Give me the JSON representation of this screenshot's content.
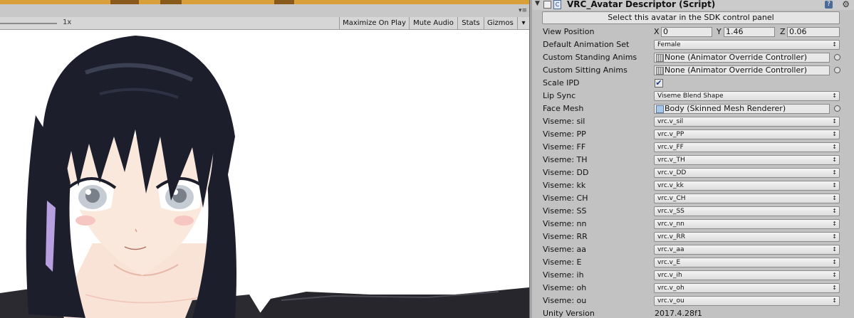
{
  "game_view": {
    "scale_label": "1x",
    "toolbar_buttons": [
      "Maximize On Play",
      "Mute Audio",
      "Stats",
      "Gizmos"
    ],
    "gizmos_arrow": "▾",
    "menu_icon": "hamburger-icon"
  },
  "inspector": {
    "component_title": "VRC_Avatar Descriptor (Script)",
    "select_button": "Select this avatar in the SDK control panel",
    "view_position": {
      "label": "View Position",
      "x_label": "X",
      "x": "0",
      "y_label": "Y",
      "y": "1.46",
      "z_label": "Z",
      "z": "0.06"
    },
    "default_animation_set": {
      "label": "Default Animation Set",
      "value": "Female"
    },
    "custom_standing_anims": {
      "label": "Custom Standing Anims",
      "value": "None (Animator Override Controller)"
    },
    "custom_sitting_anims": {
      "label": "Custom Sitting Anims",
      "value": "None (Animator Override Controller)"
    },
    "scale_ipd": {
      "label": "Scale IPD",
      "checked": true,
      "check_glyph": "✔"
    },
    "lip_sync": {
      "label": "Lip Sync",
      "value": "Viseme Blend Shape"
    },
    "face_mesh": {
      "label": "Face Mesh",
      "value": "Body (Skinned Mesh Renderer)"
    },
    "visemes": [
      {
        "label": "Viseme: sil",
        "value": "vrc.v_sil"
      },
      {
        "label": "Viseme: PP",
        "value": "vrc.v_PP"
      },
      {
        "label": "Viseme: FF",
        "value": "vrc.v_FF"
      },
      {
        "label": "Viseme: TH",
        "value": "vrc.v_TH"
      },
      {
        "label": "Viseme: DD",
        "value": "vrc.v_DD"
      },
      {
        "label": "Viseme: kk",
        "value": "vrc.v_kk"
      },
      {
        "label": "Viseme: CH",
        "value": "vrc.v_CH"
      },
      {
        "label": "Viseme: SS",
        "value": "vrc.v_SS"
      },
      {
        "label": "Viseme: nn",
        "value": "vrc.v_nn"
      },
      {
        "label": "Viseme: RR",
        "value": "vrc.v_RR"
      },
      {
        "label": "Viseme: aa",
        "value": "vrc.v_aa"
      },
      {
        "label": "Viseme: E",
        "value": "vrc.v_E"
      },
      {
        "label": "Viseme: ih",
        "value": "vrc.v_ih"
      },
      {
        "label": "Viseme: oh",
        "value": "vrc.v_oh"
      },
      {
        "label": "Viseme: ou",
        "value": "vrc.v_ou"
      }
    ],
    "unity_version": {
      "label": "Unity Version",
      "value": "2017.4.28f1"
    },
    "dropdown_arrow": "↕"
  },
  "colors": {
    "hair": "#1c1e2c",
    "skin": "#fbe8dc",
    "eye": "#c6ccd4",
    "inspector_bg": "#c2c2c2",
    "accent_ribbon": "#b8a0e0"
  }
}
